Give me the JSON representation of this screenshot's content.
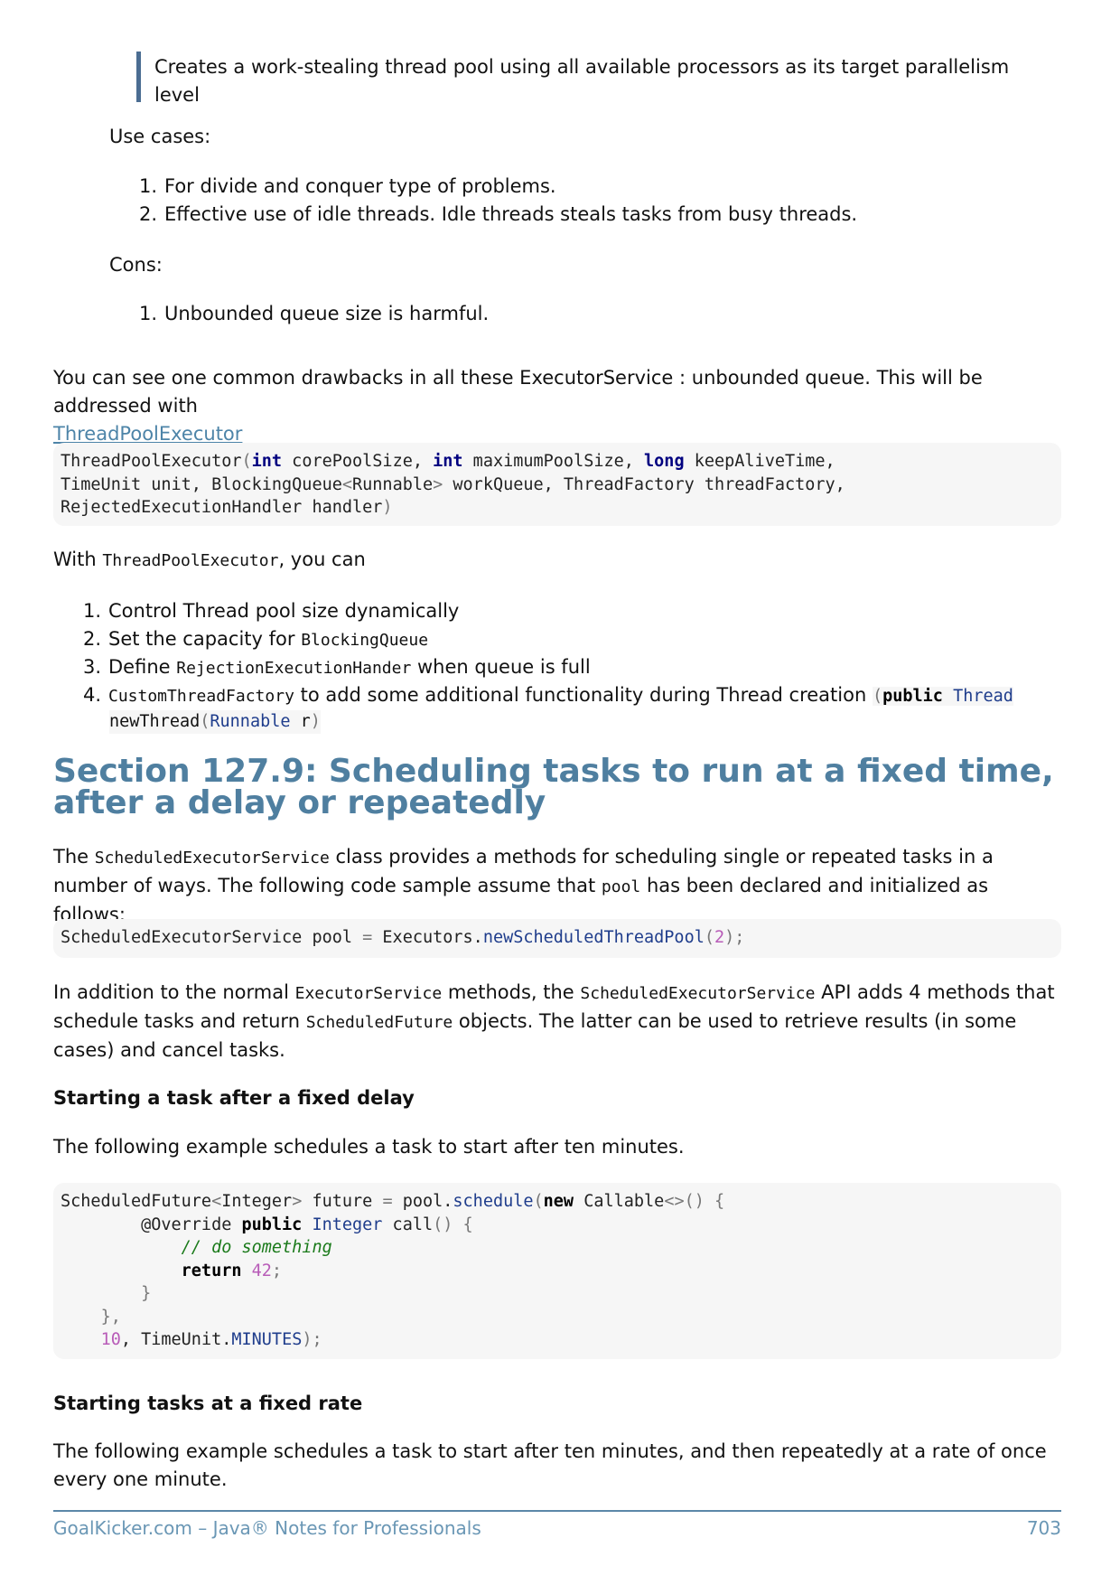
{
  "quote": "Creates a work-stealing thread pool using all available processors as its target parallelism level",
  "use_cases_label": "Use cases:",
  "use_cases": [
    {
      "n": "1.",
      "text": "For divide and conquer type of problems."
    },
    {
      "n": "2.",
      "text": "Effective use of idle threads. Idle threads steals tasks from busy threads."
    }
  ],
  "cons_label": "Cons:",
  "cons": [
    {
      "n": "1.",
      "text": "Unbounded queue size is harmful."
    }
  ],
  "drawback_text": "You can see one common drawbacks in all these ExecutorService : unbounded queue. This will be addressed with",
  "drawback_link": "ThreadPoolExecutor",
  "with_pre": "With ",
  "with_code": "ThreadPoolExecutor",
  "with_post": ", you can",
  "capabilities": {
    "item1": {
      "n": "1.",
      "text": "Control Thread pool size dynamically"
    },
    "item2": {
      "n": "2.",
      "text": "Set the capacity for ",
      "code": "BlockingQueue"
    },
    "item3": {
      "n": "3.",
      "text_pre": "Define ",
      "code": "RejectionExecutionHander",
      "text_post": " when queue is full"
    },
    "item4": {
      "n": "4.",
      "code": "CustomThreadFactory",
      "text": " to add some additional functionality during Thread creation "
    }
  },
  "section_title": "Section 127.9: Scheduling tasks to run at a fixed time, after a delay or repeatedly",
  "intro": {
    "pre": "The ",
    "code1": "ScheduledExecutorService",
    "mid": " class provides a methods for scheduling single or repeated tasks in a number of ways. The following code sample assume that ",
    "code2": "pool",
    "post": " has been declared and initialized as follows:"
  },
  "addition": {
    "p1": "In addition to the normal ",
    "c1": "ExecutorService",
    "p2": " methods, the ",
    "c2": "ScheduledExecutorService",
    "p3": " API adds 4 methods that schedule tasks and return ",
    "c3": "ScheduledFuture",
    "p4": " objects. The latter can be used to retrieve results (in some cases) and cancel tasks."
  },
  "subhead1": "Starting a task after a fixed delay",
  "para_delay": "The following example schedules a task to start after ten minutes.",
  "subhead2": "Starting tasks at a fixed rate",
  "para_rate": "The following example schedules a task to start after ten minutes, and then repeatedly at a rate of once every one minute.",
  "footer": {
    "left": "GoalKicker.com – Java® Notes for Professionals",
    "page": "703"
  },
  "colors": {
    "heading": "#4f7fa0",
    "quote_bar": "#4b6d92",
    "link": "#4d84a8",
    "code_bg": "#f6f6f6"
  }
}
